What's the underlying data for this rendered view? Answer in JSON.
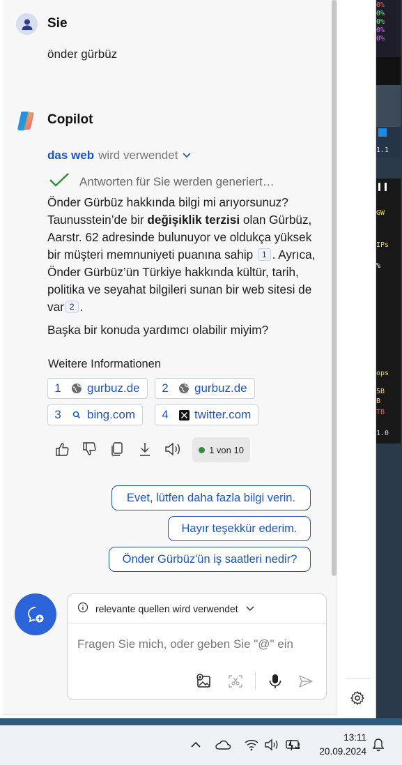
{
  "user": {
    "name": "Sie",
    "message": "önder gürbüz"
  },
  "copilot": {
    "name": "Copilot",
    "web_strong": "das web",
    "web_rest": "wird verwendet",
    "generating": "Antworten für Sie werden generiert…",
    "answer": {
      "p1": "Önder Gürbüz hakkında bilgi mi arıyorsunuz? Taunusstein’de bir ",
      "bold": "değişiklik terzisi",
      "p2": " olan Gürbüz, Aarstr. 62 adresinde bulunuyor ve oldukça yüksek bir müşteri memnuniyeti puanına sahip ",
      "cite1": "1",
      "p3": ". Ayrıca, Önder Gürbüz’ün Türkiye hakkında kültür, tarih, politika ve seyahat bilgileri sunan bir web sitesi de var",
      "cite2": "2",
      "p4": "."
    },
    "followup_question": "Başka bir konuda yardımcı olabilir miyim?",
    "more_info_label": "Weitere Informationen",
    "sources": [
      {
        "num": "1",
        "label": "gurbuz.de",
        "icon": "globe-icon"
      },
      {
        "num": "2",
        "label": "gurbuz.de",
        "icon": "globe-icon"
      },
      {
        "num": "3",
        "label": "bing.com",
        "icon": "search-icon"
      },
      {
        "num": "4",
        "label": "twitter.com",
        "icon": "x-logo-icon"
      }
    ],
    "page_indicator": "1 von 10"
  },
  "suggestions": [
    "Evet, lütfen daha fazla bilgi verin.",
    "Hayır teşekkür ederim.",
    "Önder Gürbüz'ün iş saatleri nedir?"
  ],
  "input": {
    "header": "relevante quellen wird verwendet",
    "placeholder": "Fragen Sie mich, oder geben Sie \"@\" ein"
  },
  "taskbar": {
    "time": "13:11",
    "date": "20.09.2024"
  },
  "desk_strip": {
    "meters": [
      "0%",
      "0%",
      "0%",
      "0%",
      "0%"
    ],
    "labels": [
      "1.1",
      "GW",
      "IPs",
      "%",
      "ops",
      "5B",
      "B",
      "TB",
      "1.0"
    ]
  },
  "colors": {
    "accent": "#1a55c8",
    "new_topic": "#2b63d9",
    "success": "#2f8a3a"
  }
}
